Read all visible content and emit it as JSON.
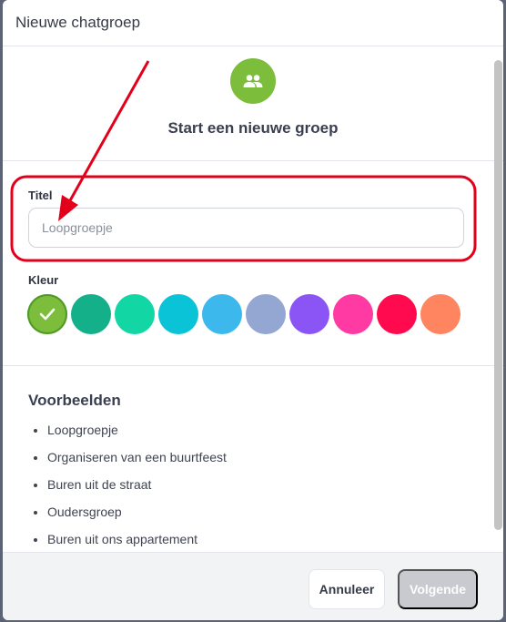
{
  "dialog": {
    "title": "Nieuwe chatgroep"
  },
  "hero": {
    "icon": "group-icon",
    "title": "Start een nieuwe groep",
    "accent": "#7cbd3c"
  },
  "form": {
    "title_label": "Titel",
    "title_placeholder": "Loopgroepje",
    "title_value": "",
    "color_label": "Kleur",
    "colors": [
      "#7cbd3c",
      "#14b08a",
      "#12d6a4",
      "#0ac3d6",
      "#3db8ec",
      "#94a6d2",
      "#8b55f5",
      "#ff3aa3",
      "#ff0a4e",
      "#ff8561"
    ],
    "selected_color": "#7cbd3c"
  },
  "examples": {
    "heading": "Voorbeelden",
    "items": [
      "Loopgroepje",
      "Organiseren van een buurtfeest",
      "Buren uit de straat",
      "Oudersgroep",
      "Buren uit ons appartement"
    ]
  },
  "footer": {
    "cancel_label": "Annuleer",
    "next_label": "Volgende"
  },
  "annotation_color": "#e3001b"
}
